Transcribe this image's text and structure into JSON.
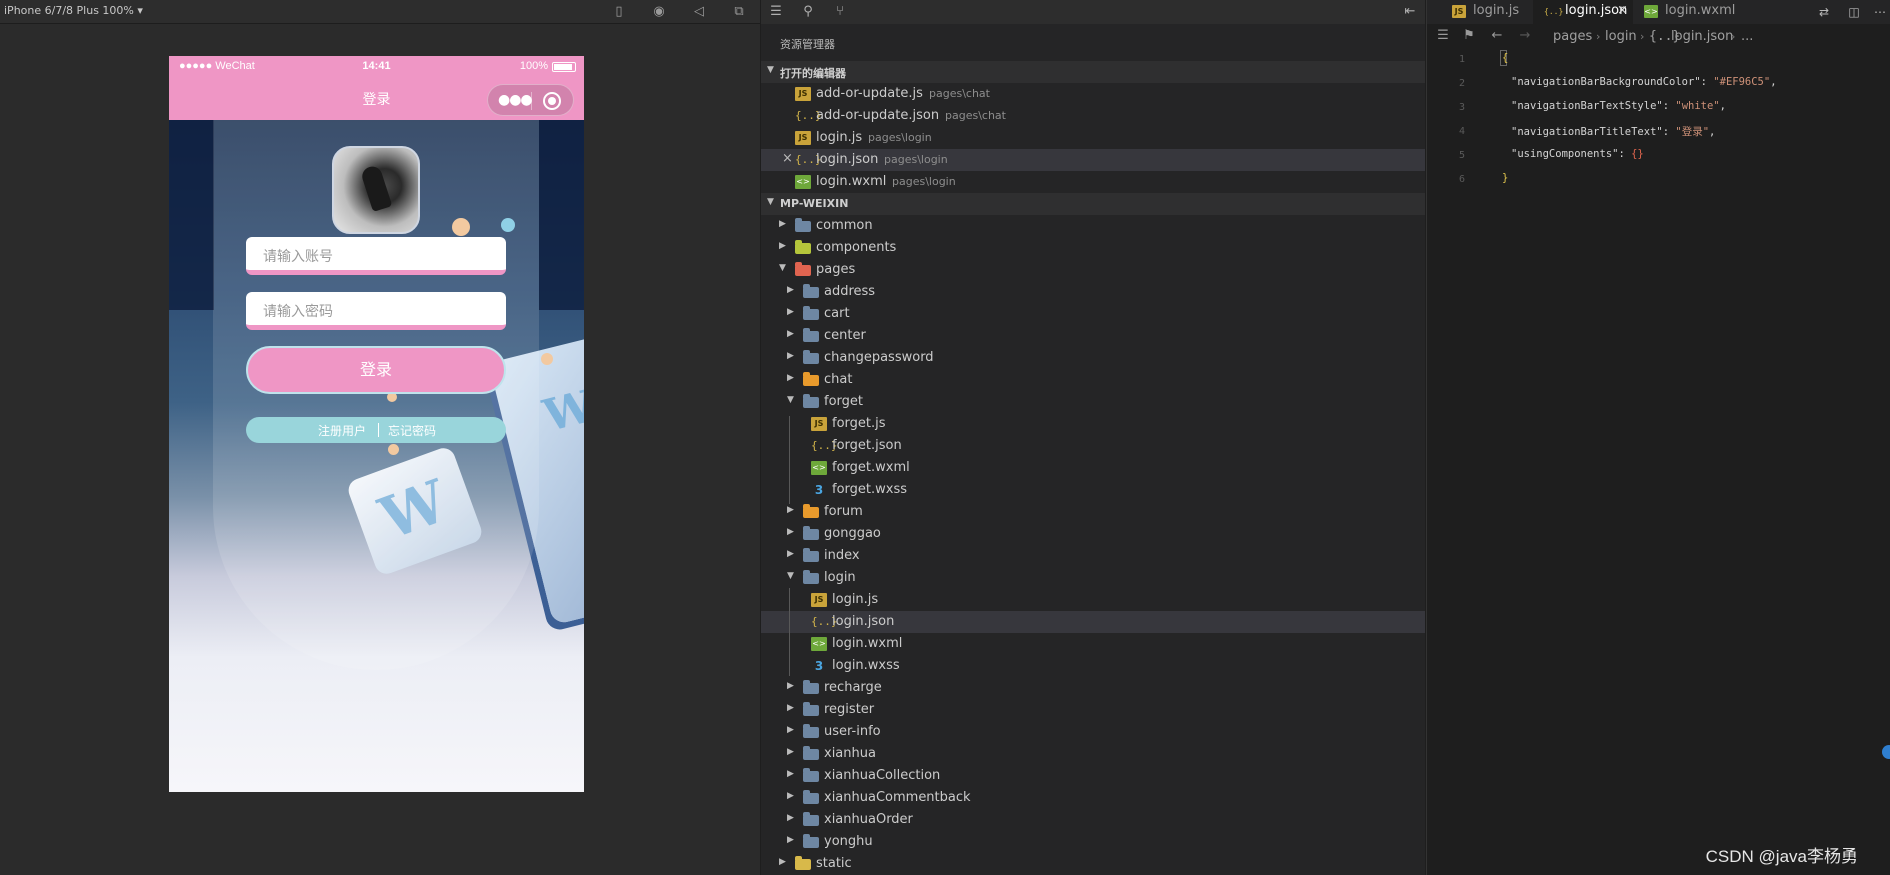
{
  "simulator": {
    "device": "iPhone 6/7/8 Plus 100% ▾",
    "phone": {
      "status_carrier": "●●●●● WeChat",
      "status_time": "14:41",
      "status_battery": "100%",
      "nav_title": "登录",
      "nav_bg_color": "#EF96C5",
      "account_placeholder": "请输入账号",
      "password_placeholder": "请输入密码",
      "login_button": "登录",
      "register_link": "注册用户",
      "forget_link": "忘记密码"
    }
  },
  "explorer": {
    "title": "资源管理器",
    "open_editors_label": "打开的编辑器",
    "open_editors": [
      {
        "name": "add-or-update.js",
        "path": "pages\\chat",
        "icon": "js-file-icon"
      },
      {
        "name": "add-or-update.json",
        "path": "pages\\chat",
        "icon": "json-file-icon"
      },
      {
        "name": "login.js",
        "path": "pages\\login",
        "icon": "js-file-icon"
      },
      {
        "name": "login.json",
        "path": "pages\\login",
        "icon": "json-file-icon",
        "close": "×"
      },
      {
        "name": "login.wxml",
        "path": "pages\\login",
        "icon": "wxml-file-icon"
      }
    ],
    "project_label": "MP-WEIXIN",
    "tree": [
      "common",
      "components",
      "pages",
      "address",
      "cart",
      "center",
      "changepassword",
      "chat",
      "forget",
      "forget.js",
      "forget.json",
      "forget.wxml",
      "forget.wxss",
      "forum",
      "gonggao",
      "index",
      "login",
      "login.js",
      "login.json",
      "login.wxml",
      "login.wxss",
      "recharge",
      "register",
      "user-info",
      "xianhua",
      "xianhuaCollection",
      "xianhuaCommentback",
      "xianhuaOrder",
      "yonghu",
      "static"
    ]
  },
  "editor": {
    "tabs": [
      {
        "label": "login.js",
        "icon": "js-file-icon"
      },
      {
        "label": "login.json",
        "icon": "json-file-icon",
        "close": "×"
      },
      {
        "label": "login.wxml",
        "icon": "wxml-file-icon"
      }
    ],
    "breadcrumb": [
      "pages",
      "login",
      "login.json",
      "..."
    ],
    "line_numbers": [
      "1",
      "2",
      "3",
      "4",
      "5",
      "6"
    ],
    "code": {
      "open_brace": "{",
      "key1": "\"navigationBarBackgroundColor\": ",
      "val1": "\"#EF96C5\"",
      "key2": "\"navigationBarTextStyle\": ",
      "val2": "\"white\"",
      "key3": "\"navigationBarTitleText\": ",
      "val3": "\"登录\"",
      "key4": "\"usingComponents\": ",
      "val4": "{}",
      "close_brace": "}"
    },
    "watermark": "CSDN @java李杨勇"
  }
}
